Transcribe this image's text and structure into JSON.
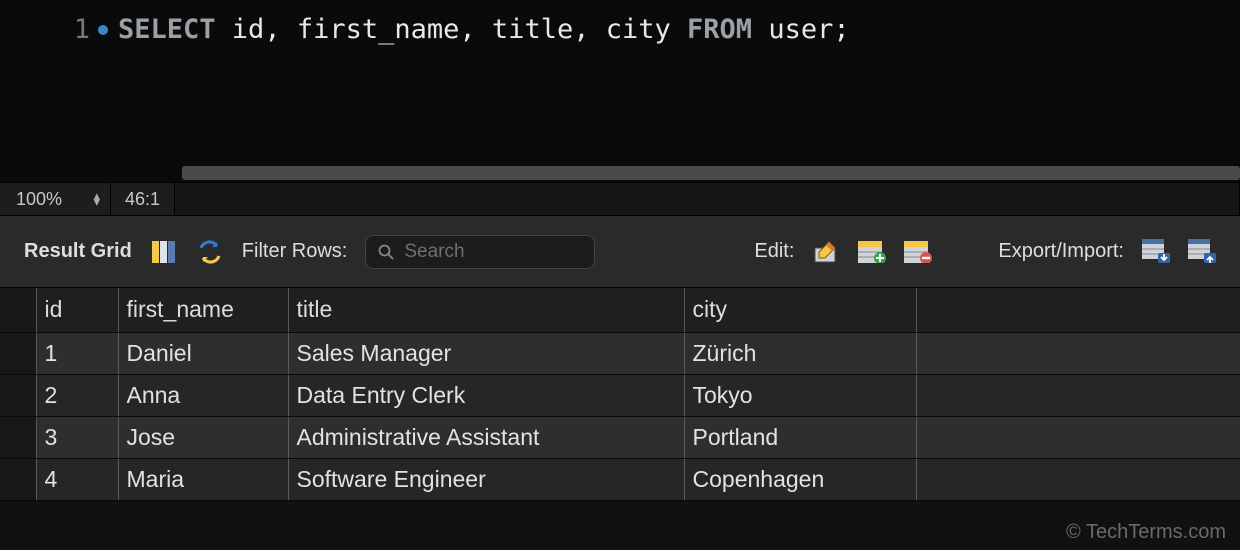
{
  "editor": {
    "line_number": "1",
    "sql_tokens": [
      {
        "t": "SELECT",
        "c": "kw"
      },
      {
        "t": " id",
        "c": "ident"
      },
      {
        "t": ",",
        "c": "punct"
      },
      {
        "t": " first_name",
        "c": "ident"
      },
      {
        "t": ",",
        "c": "punct"
      },
      {
        "t": " title",
        "c": "ident"
      },
      {
        "t": ",",
        "c": "punct"
      },
      {
        "t": " city ",
        "c": "ident"
      },
      {
        "t": "FROM",
        "c": "kw"
      },
      {
        "t": " user",
        "c": "ident"
      },
      {
        "t": ";",
        "c": "punct"
      }
    ]
  },
  "status": {
    "zoom": "100%",
    "cursor": "46:1"
  },
  "toolbar": {
    "result_grid": "Result Grid",
    "filter_label": "Filter Rows:",
    "search_placeholder": "Search",
    "edit_label": "Edit:",
    "export_label": "Export/Import:"
  },
  "grid": {
    "columns": [
      "id",
      "first_name",
      "title",
      "city"
    ],
    "rows": [
      {
        "id": "1",
        "first_name": "Daniel",
        "title": "Sales Manager",
        "city": "Zürich"
      },
      {
        "id": "2",
        "first_name": "Anna",
        "title": "Data Entry Clerk",
        "city": "Tokyo"
      },
      {
        "id": "3",
        "first_name": "Jose",
        "title": "Administrative Assistant",
        "city": "Portland"
      },
      {
        "id": "4",
        "first_name": "Maria",
        "title": "Software Engineer",
        "city": "Copenhagen"
      }
    ]
  },
  "watermark": "© TechTerms.com"
}
